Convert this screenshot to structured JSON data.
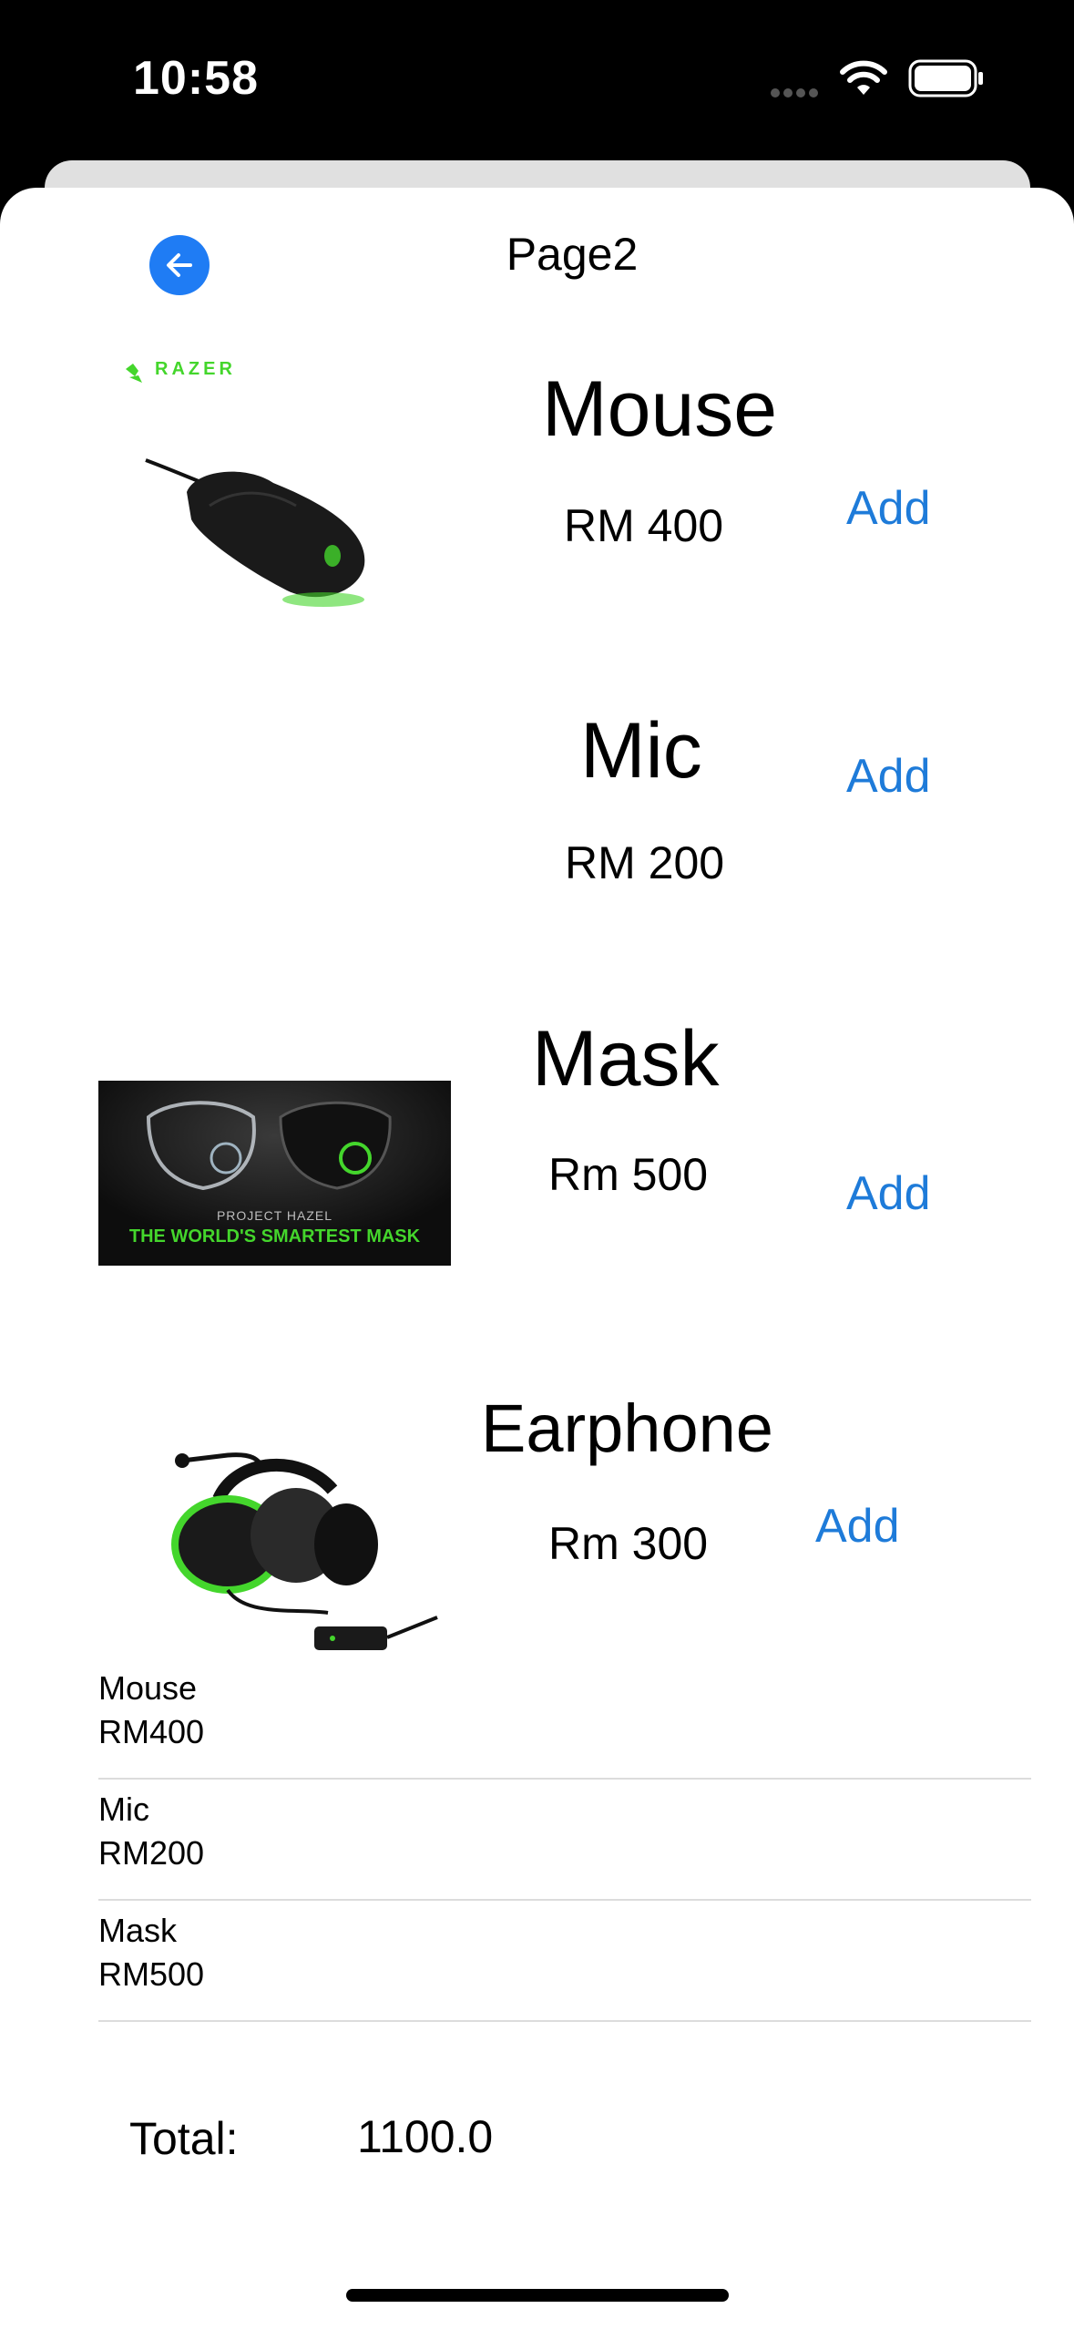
{
  "status_bar": {
    "time": "10:58"
  },
  "nav": {
    "title": "Page2",
    "back_icon": "arrow-left-icon"
  },
  "products": [
    {
      "name": "Mouse",
      "price": "RM 400",
      "add_label": "Add",
      "image_logo": "RAZER"
    },
    {
      "name": "Mic",
      "price": "RM 200",
      "add_label": "Add"
    },
    {
      "name": "Mask",
      "price": "Rm 500",
      "add_label": "Add",
      "image_caption_small": "PROJECT HAZEL",
      "image_caption": "THE WORLD'S SMARTEST MASK"
    },
    {
      "name": "Earphone",
      "price": "Rm 300",
      "add_label": "Add"
    }
  ],
  "cart": [
    {
      "name": "Mouse",
      "price": "RM400"
    },
    {
      "name": "Mic",
      "price": "RM200"
    },
    {
      "name": "Mask",
      "price": "RM500"
    }
  ],
  "summary": {
    "total_label": "Total:",
    "total_value": "1100.0"
  },
  "colors": {
    "accent": "#1e7bd9",
    "back_button": "#1f7cf4",
    "razer_green": "#44d62c"
  }
}
